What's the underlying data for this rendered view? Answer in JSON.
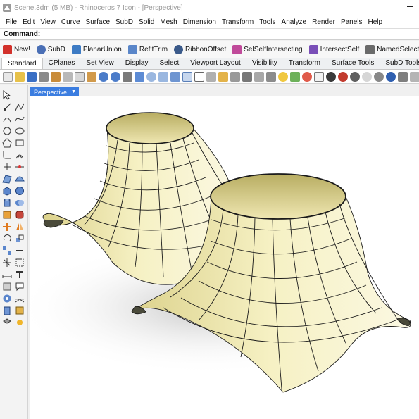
{
  "window": {
    "title": "Scene.3dm (5 MB) - Rhinoceros 7 Icon - [Perspective]"
  },
  "menu": [
    "File",
    "Edit",
    "View",
    "Curve",
    "Surface",
    "SubD",
    "Solid",
    "Mesh",
    "Dimension",
    "Transform",
    "Tools",
    "Analyze",
    "Render",
    "Panels",
    "Help"
  ],
  "command": {
    "label": "Command:"
  },
  "macros": [
    {
      "label": "New!",
      "color": "#d2312b"
    },
    {
      "label": "SubD",
      "color": "#4a6fb5"
    },
    {
      "label": "PlanarUnion",
      "color": "#3d7bc4"
    },
    {
      "label": "RefitTrim",
      "color": "#5a86c9"
    },
    {
      "label": "RibbonOffset",
      "color": "#3b5a8a"
    },
    {
      "label": "SelSelfIntersecting",
      "color": "#c04a9a"
    },
    {
      "label": "IntersectSelf",
      "color": "#7a4fb8"
    },
    {
      "label": "NamedSelection",
      "color": "#6a6a6a"
    }
  ],
  "tabs": [
    "Standard",
    "CPlanes",
    "Set View",
    "Display",
    "Select",
    "Viewport Layout",
    "Visibility",
    "Transform",
    "Surface Tools",
    "SubD Tools"
  ],
  "viewport": {
    "label": "Perspective",
    "surface_color": "#f3edb5",
    "wire_color": "#1a1a1a"
  }
}
